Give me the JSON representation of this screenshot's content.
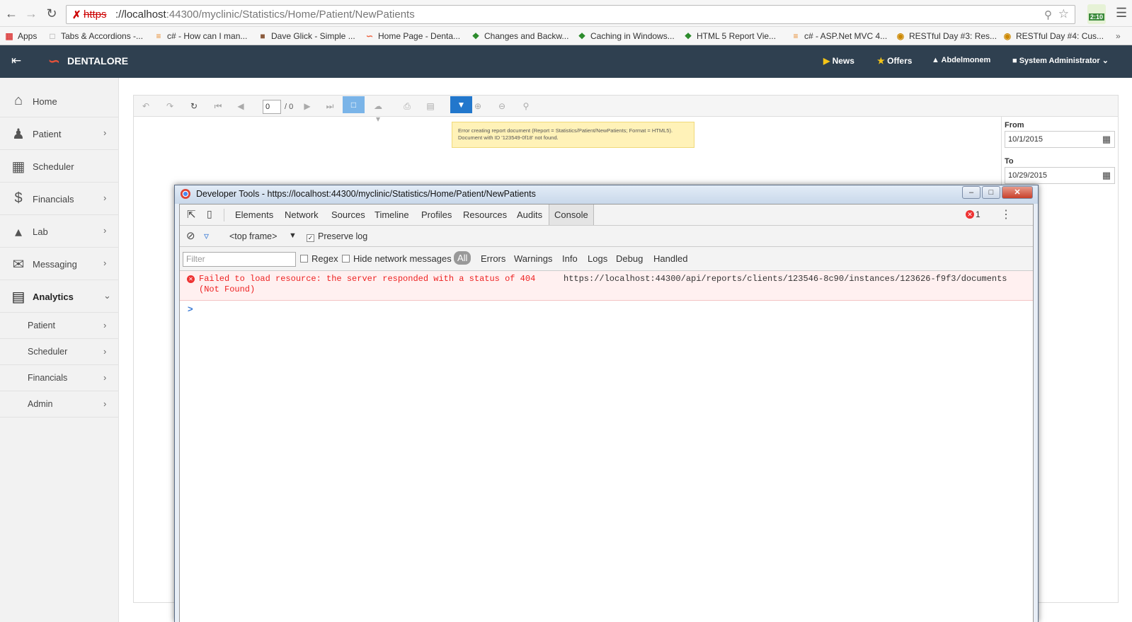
{
  "browser": {
    "url_scheme": "https",
    "url_rest": "://localhost",
    "url_path": ":44300/myclinic/Statistics/Home/Patient/NewPatients",
    "clock": "2:10",
    "bookmarks": [
      "Apps",
      "Tabs & Accordions -...",
      "c# - How can I man...",
      "Dave Glick - Simple ...",
      "Home Page - Denta...",
      "Changes and Backw...",
      "Caching in Windows...",
      "HTML 5 Report Vie...",
      "c# - ASP.Net MVC 4...",
      "RESTful Day #3: Res...",
      "RESTful Day #4: Cus..."
    ]
  },
  "app": {
    "brand": "DENTALORE",
    "header_links": {
      "news": "News",
      "offers": "Offers",
      "user": "Abdelmonem",
      "role": "System Administrator"
    }
  },
  "sidebar": {
    "items": [
      {
        "label": "Home",
        "icon": "home-icon"
      },
      {
        "label": "Patient",
        "icon": "person-icon"
      },
      {
        "label": "Scheduler",
        "icon": "calendar-icon"
      },
      {
        "label": "Financials",
        "icon": "dollar-icon"
      },
      {
        "label": "Lab",
        "icon": "flask-icon"
      },
      {
        "label": "Messaging",
        "icon": "envelope-icon"
      },
      {
        "label": "Analytics",
        "icon": "bar-chart-icon"
      }
    ],
    "subitems": [
      "Patient",
      "Scheduler",
      "Financials",
      "Admin"
    ]
  },
  "report": {
    "page_current": "0",
    "page_total": "/ 0",
    "error_line1": "Error creating report document (Report = Statistics/Patient/NewPatients; Format = HTML5).",
    "error_line2": "Document with ID '123549-0f18' not found.",
    "from_label": "From",
    "from_value": "10/1/2015",
    "to_label": "To",
    "to_value": "10/29/2015"
  },
  "devtools": {
    "window_title": "Developer Tools - https://localhost:44300/myclinic/Statistics/Home/Patient/NewPatients",
    "tabs": [
      "Elements",
      "Network",
      "Sources",
      "Timeline",
      "Profiles",
      "Resources",
      "Audits",
      "Console"
    ],
    "active_tab": "Console",
    "error_count": "1",
    "frame": "<top frame>",
    "preserve_log": "Preserve log",
    "filter_placeholder": "Filter",
    "regex": "Regex",
    "hide_network": "Hide network messages",
    "levels": [
      "All",
      "Errors",
      "Warnings",
      "Info",
      "Logs",
      "Debug",
      "Handled"
    ],
    "error_message": "Failed to load resource: the server responded with a status of 404",
    "error_message_cont": "(Not Found)",
    "error_url": "https://localhost:44300/api/reports/clients/123546-8c90/instances/123626-f9f3/documents",
    "prompt": ">"
  }
}
